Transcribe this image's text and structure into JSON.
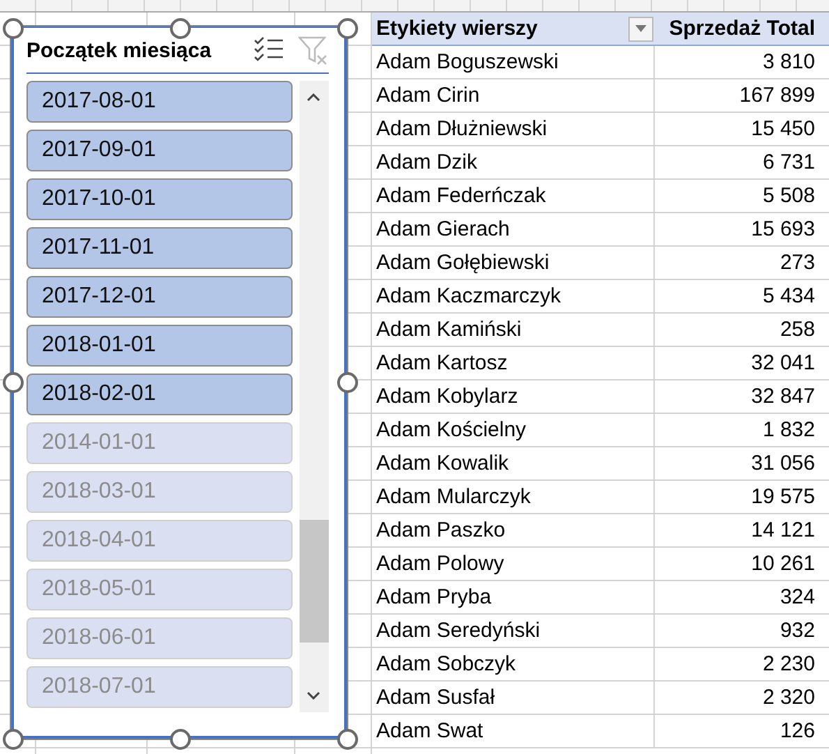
{
  "slicer": {
    "title": "Początek miesiąca",
    "items": [
      {
        "label": "2017-08-01",
        "selected": true
      },
      {
        "label": "2017-09-01",
        "selected": true
      },
      {
        "label": "2017-10-01",
        "selected": true
      },
      {
        "label": "2017-11-01",
        "selected": true
      },
      {
        "label": "2017-12-01",
        "selected": true
      },
      {
        "label": "2018-01-01",
        "selected": true
      },
      {
        "label": "2018-02-01",
        "selected": true
      },
      {
        "label": "2014-01-01",
        "selected": false
      },
      {
        "label": "2018-03-01",
        "selected": false
      },
      {
        "label": "2018-04-01",
        "selected": false
      },
      {
        "label": "2018-05-01",
        "selected": false
      },
      {
        "label": "2018-06-01",
        "selected": false
      },
      {
        "label": "2018-07-01",
        "selected": false
      }
    ]
  },
  "pivot": {
    "columns": [
      "Etykiety wierszy",
      "Sprzedaż Total"
    ],
    "rows": [
      [
        "Adam Boguszewski",
        "3 810"
      ],
      [
        "Adam Cirin",
        "167 899"
      ],
      [
        "Adam Dłużniewski",
        "15 450"
      ],
      [
        "Adam Dzik",
        "6 731"
      ],
      [
        "Adam Federńczak",
        "5 508"
      ],
      [
        "Adam Gierach",
        "15 693"
      ],
      [
        "Adam Gołębiewski",
        "273"
      ],
      [
        "Adam Kaczmarczyk",
        "5 434"
      ],
      [
        "Adam Kamiński",
        "258"
      ],
      [
        "Adam Kartosz",
        "32 041"
      ],
      [
        "Adam Kobylarz",
        "32 847"
      ],
      [
        "Adam Kościelny",
        "1 832"
      ],
      [
        "Adam Kowalik",
        "31 056"
      ],
      [
        "Adam Mularczyk",
        "19 575"
      ],
      [
        "Adam Paszko",
        "14 121"
      ],
      [
        "Adam Polowy",
        "10 261"
      ],
      [
        "Adam Pryba",
        "324"
      ],
      [
        "Adam Seredyński",
        "932"
      ],
      [
        "Adam Sobczyk",
        "2 230"
      ],
      [
        "Adam Susfał",
        "2 320"
      ],
      [
        "Adam Swat",
        "126"
      ]
    ]
  }
}
